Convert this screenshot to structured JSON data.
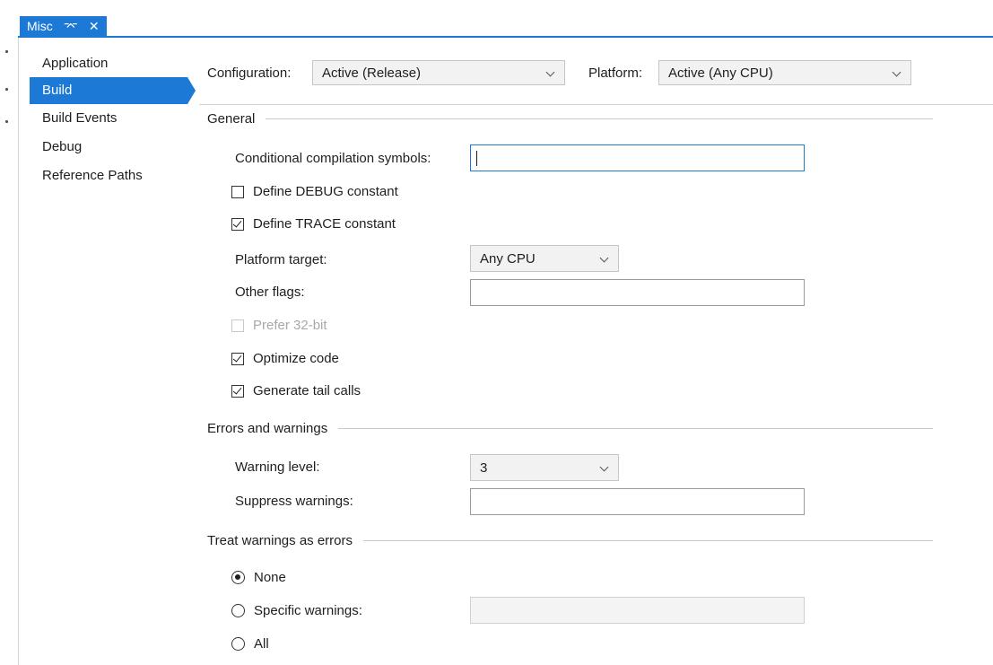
{
  "tab": {
    "title": "Misc",
    "pin_glyph": "⌤",
    "close_glyph": "✕"
  },
  "nav": {
    "items": [
      {
        "label": "Application"
      },
      {
        "label": "Build",
        "selected": true
      },
      {
        "label": "Build Events"
      },
      {
        "label": "Debug"
      },
      {
        "label": "Reference Paths"
      }
    ]
  },
  "header": {
    "configuration_label": "Configuration:",
    "configuration_value": "Active (Release)",
    "platform_label": "Platform:",
    "platform_value": "Active (Any CPU)"
  },
  "general": {
    "title": "General",
    "conditional_symbols_label": "Conditional compilation symbols:",
    "conditional_symbols_value": "",
    "define_debug_label": "Define DEBUG constant",
    "define_debug_checked": false,
    "define_trace_label": "Define TRACE constant",
    "define_trace_checked": true,
    "platform_target_label": "Platform target:",
    "platform_target_value": "Any CPU",
    "other_flags_label": "Other flags:",
    "other_flags_value": "",
    "prefer32_label": "Prefer 32-bit",
    "prefer32_checked": false,
    "prefer32_enabled": false,
    "optimize_label": "Optimize code",
    "optimize_checked": true,
    "tailcalls_label": "Generate tail calls",
    "tailcalls_checked": true
  },
  "errors": {
    "title": "Errors and warnings",
    "warning_level_label": "Warning level:",
    "warning_level_value": "3",
    "suppress_label": "Suppress warnings:",
    "suppress_value": ""
  },
  "treat": {
    "title": "Treat warnings as errors",
    "none_label": "None",
    "specific_label": "Specific warnings:",
    "all_label": "All",
    "selected": "None",
    "specific_value": ""
  },
  "colors": {
    "accent": "#1c7ad6"
  }
}
